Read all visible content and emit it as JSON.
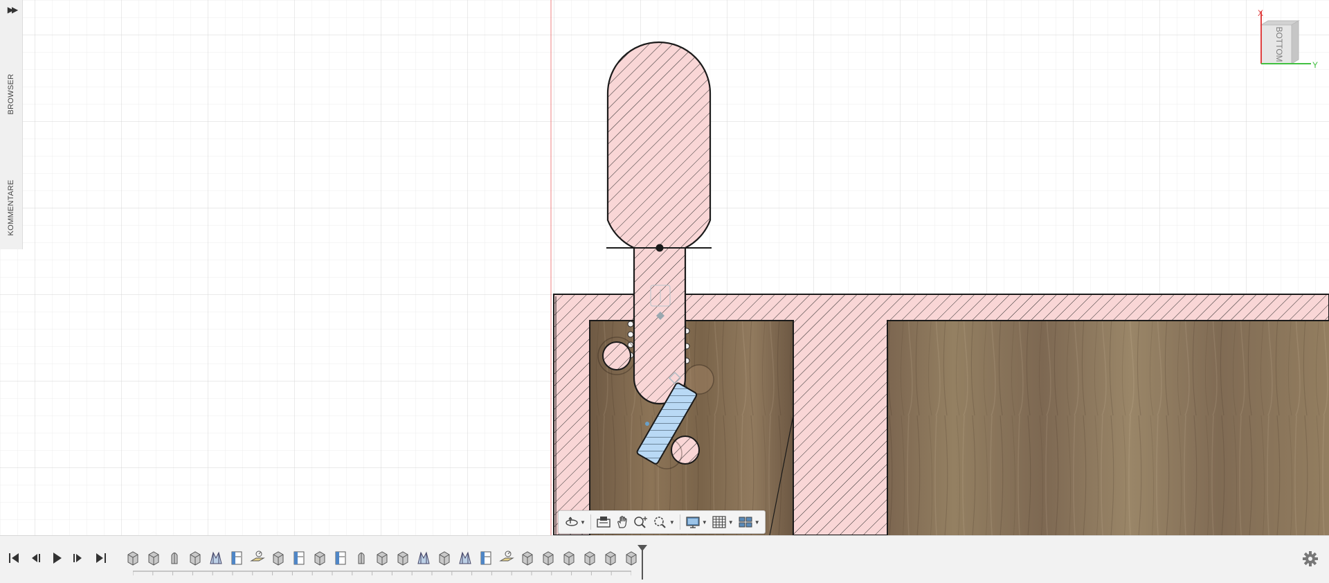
{
  "sidebar": {
    "expand_icon": "double-chevron-right-icon",
    "tabs": [
      {
        "label": "BROWSER"
      },
      {
        "label": "KOMMENTARE"
      }
    ]
  },
  "viewcube": {
    "face_label": "BOTTOM",
    "axis_x": "X",
    "axis_y": "Y"
  },
  "nav_toolbar": {
    "tools": [
      {
        "icon": "orbit-icon",
        "has_dropdown": true
      },
      {
        "icon": "look-at-icon",
        "has_dropdown": false
      },
      {
        "icon": "pan-hand-icon",
        "has_dropdown": false
      },
      {
        "icon": "zoom-icon",
        "has_dropdown": false
      },
      {
        "icon": "zoom-window-icon",
        "has_dropdown": true
      },
      {
        "icon": "display-settings-icon",
        "has_dropdown": true
      },
      {
        "icon": "grid-settings-icon",
        "has_dropdown": true
      },
      {
        "icon": "viewports-icon",
        "has_dropdown": true
      }
    ]
  },
  "timeline": {
    "controls": [
      "skip-to-start-icon",
      "step-back-icon",
      "play-icon",
      "step-forward-icon",
      "skip-to-end-icon"
    ],
    "features": [
      "extrude",
      "extrude",
      "revolve",
      "extrude",
      "loft",
      "sketch",
      "offset-plane",
      "extrude",
      "sketch",
      "extrude",
      "sketch",
      "revolve",
      "extrude",
      "extrude",
      "loft",
      "extrude",
      "loft",
      "sketch",
      "offset-plane",
      "extrude",
      "extrude",
      "extrude",
      "extrude",
      "extrude",
      "extrude"
    ],
    "settings_icon": "gear-icon"
  },
  "colors": {
    "section_fill": "#f9d6d6",
    "section_stroke": "#1a1a1a",
    "blue_part": "#b9d9f5",
    "wood": "#8a6f50",
    "origin_axis_red": "#ef8080",
    "grid_major": "#d7d7d7",
    "grid_minor": "#ececec"
  }
}
